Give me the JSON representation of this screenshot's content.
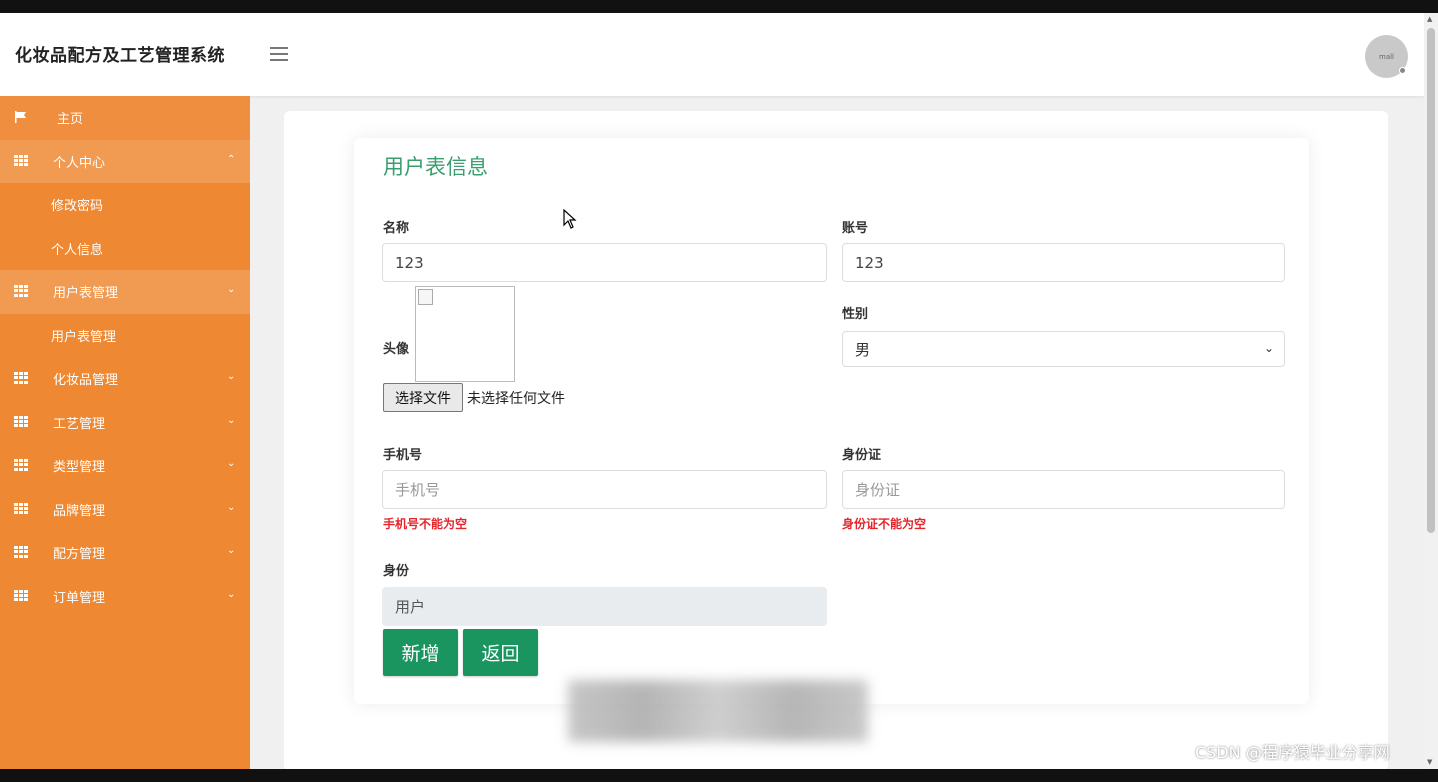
{
  "app": {
    "title": "化妆品配方及工艺管理系统",
    "avatar_text": "mall"
  },
  "sidebar": {
    "home": "主页",
    "groups": [
      {
        "label": "个人中心",
        "expanded": true,
        "arrow": "⌃",
        "children": [
          "修改密码",
          "个人信息"
        ]
      },
      {
        "label": "用户表管理",
        "expanded": true,
        "arrow": "⌄",
        "children": [
          "用户表管理"
        ]
      },
      {
        "label": "化妆品管理",
        "expanded": false,
        "arrow": "⌄"
      },
      {
        "label": "工艺管理",
        "expanded": false,
        "arrow": "⌄"
      },
      {
        "label": "类型管理",
        "expanded": false,
        "arrow": "⌄"
      },
      {
        "label": "品牌管理",
        "expanded": false,
        "arrow": "⌄"
      },
      {
        "label": "配方管理",
        "expanded": false,
        "arrow": "⌄"
      },
      {
        "label": "订单管理",
        "expanded": false,
        "arrow": "⌄"
      }
    ]
  },
  "form": {
    "title": "用户表信息",
    "name": {
      "label": "名称",
      "value": "123"
    },
    "account": {
      "label": "账号",
      "value": "123"
    },
    "avatar": {
      "label": "头像",
      "file_button": "选择文件",
      "file_status": "未选择任何文件"
    },
    "gender": {
      "label": "性别",
      "selected": "男"
    },
    "phone": {
      "label": "手机号",
      "placeholder": "手机号",
      "error": "手机号不能为空"
    },
    "id_card": {
      "label": "身份证",
      "placeholder": "身份证",
      "error": "身份证不能为空"
    },
    "role": {
      "label": "身份",
      "value": "用户"
    },
    "buttons": {
      "add": "新增",
      "back": "返回"
    }
  },
  "watermark": "CSDN @程序猿毕业分享网",
  "colors": {
    "sidebar": "#ee8833",
    "primary_button": "#1a9560",
    "title_green": "#3a9e6e",
    "error": "#e4262c"
  }
}
